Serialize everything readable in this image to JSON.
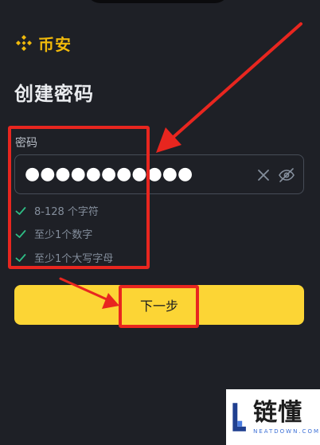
{
  "brand": {
    "name": "币安",
    "color": "#f0b90b",
    "icon": "binance-logo-icon"
  },
  "page": {
    "title": "创建密码"
  },
  "password_field": {
    "label": "密码",
    "masked_value": "●●●●●●●●●●●",
    "clear_icon": "close-icon",
    "visibility_icon": "eye-off-icon"
  },
  "requirements": [
    {
      "text": "8-128 个字符",
      "met": true
    },
    {
      "text": "至少1个数字",
      "met": true
    },
    {
      "text": "至少1个大写字母",
      "met": true
    }
  ],
  "primary_button": {
    "label": "下一步",
    "color": "#fcd535"
  },
  "annotations": {
    "highlight_color": "#e8261f"
  },
  "watermark": {
    "title": "链懂",
    "subtitle": "NEATDOWN.COM"
  }
}
